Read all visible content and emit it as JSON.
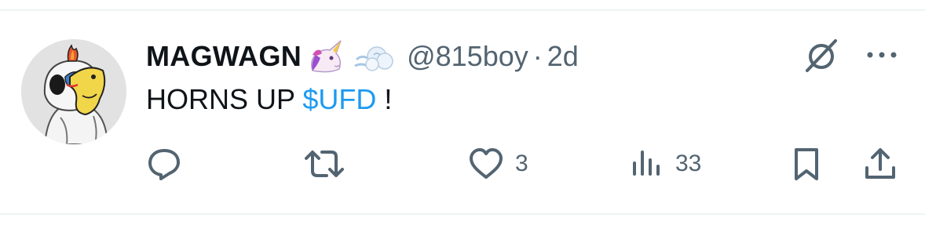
{
  "tweet": {
    "display_name": "MAGWAGN",
    "name_emojis": [
      "unicorn-emoji",
      "dash-emoji"
    ],
    "handle": "@815boy",
    "separator": "·",
    "time": "2d",
    "text_before": "HORNS UP ",
    "cashtag": "$UFD",
    "text_after": " !"
  },
  "actions": {
    "reply_count": "",
    "retweet_count": "",
    "like_count": "3",
    "views_count": "33"
  },
  "colors": {
    "text_primary": "#0f1419",
    "text_secondary": "#536471",
    "link": "#1d9bf0",
    "divider": "#eff3f4"
  },
  "icons": {
    "grok": "grok-icon",
    "more": "more-icon",
    "reply": "reply-icon",
    "retweet": "retweet-icon",
    "like": "heart-icon",
    "views": "views-icon",
    "bookmark": "bookmark-icon",
    "share": "share-icon"
  }
}
